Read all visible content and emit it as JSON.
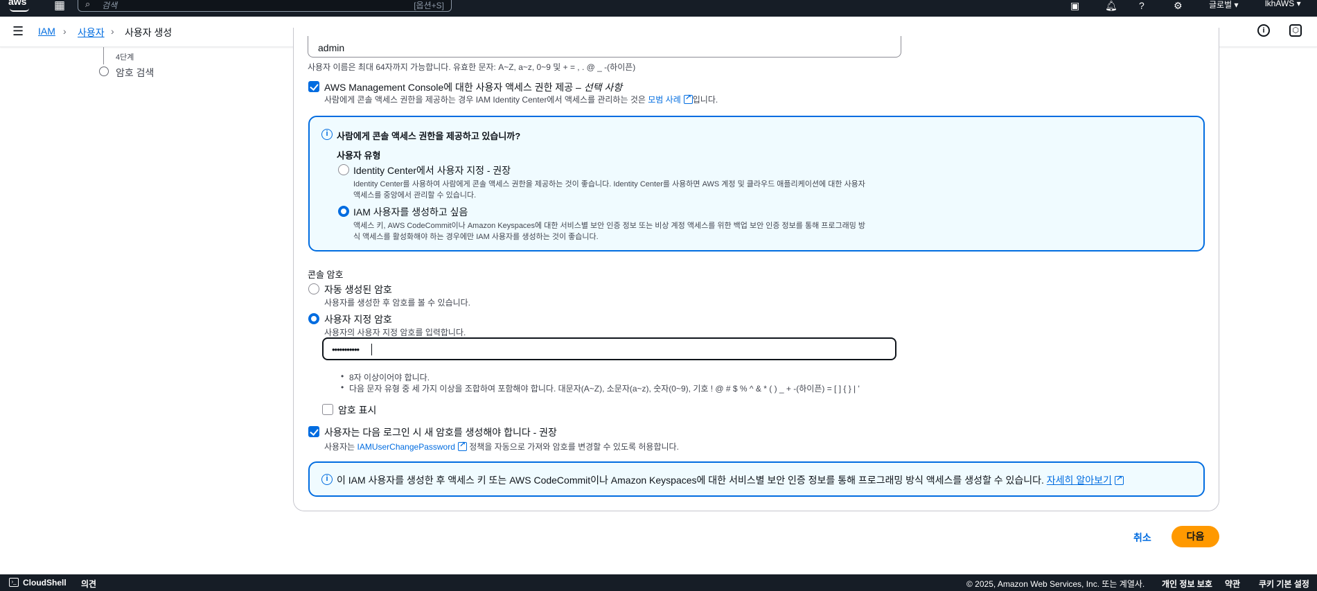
{
  "topbar": {
    "logo": "aws",
    "search_placeholder": "검색",
    "search_shortcut": "[옵션+S]",
    "region": "글로벌 ▾",
    "account": "lkhAWS ▾",
    "icons": [
      "cloudshell-icon",
      "bell-icon",
      "help-icon",
      "gear-icon"
    ]
  },
  "breadcrumb": {
    "items": [
      "IAM",
      "사용자",
      "사용자 생성"
    ]
  },
  "sidebar": {
    "step_label": "4단계",
    "step_title": "암호 검색"
  },
  "form": {
    "username_value": "admin",
    "username_hint": "사용자 이름은 최대 64자까지 가능합니다. 유효한 문자: A~Z, a~z, 0~9 및 + = , . @ _ -(하이픈)",
    "console_access_label": "AWS Management Console에 대한 사용자 액세스 권한 제공 – ",
    "console_access_optional": "선택 사항",
    "console_access_desc_pre": "사람에게 콘솔 액세스 권한을 제공하는 경우 IAM Identity Center에서 액세스를 관리하는 것은 ",
    "console_access_link": "모범 사례",
    "console_access_desc_post": "입니다.",
    "console_access_checked": true,
    "infobox1": {
      "title": "사람에게 콘솔 액세스 권한을 제공하고 있습니까?",
      "user_type_label": "사용자 유형",
      "option1_label": "Identity Center에서 사용자 지정 - 권장",
      "option1_desc1": "Identity Center를 사용하여 사람에게 콘솔 액세스 권한을 제공하는 것이 좋습니다. Identity Center를 사용하면 AWS 계정 및 클라우드 애플리케이션에 대한 사용자",
      "option1_desc2": "액세스를 중앙에서 관리할 수 있습니다.",
      "option2_label": "IAM 사용자를 생성하고 싶음",
      "option2_desc1": "액세스 키, AWS CodeCommit이나 Amazon Keyspaces에 대한 서비스별 보안 인증 정보 또는 비상 계정 액세스를 위한 백업 보안 인증 정보를 통해 프로그래밍 방",
      "option2_desc2": "식 액세스를 활성화해야 하는 경우에만 IAM 사용자를 생성하는 것이 좋습니다.",
      "selected": "option2"
    },
    "console_password": {
      "section_label": "콘솔 암호",
      "auto_label": "자동 생성된 암호",
      "auto_desc": "사용자를 생성한 후 암호를 볼 수 있습니다.",
      "custom_label": "사용자 지정 암호",
      "custom_desc": "사용자의 사용자 지정 암호를 입력합니다.",
      "selected": "custom",
      "password_value": "•••••••••••",
      "rule1": "8자 이상이어야 합니다.",
      "rule2": "다음 문자 유형 중 세 가지 이상을 조합하여 포함해야 합니다. 대문자(A~Z), 소문자(a~z), 숫자(0~9), 기호 ! @ # $ % ^ & * ( ) _ + -(하이픈) = [ ] { } | '",
      "show_password_label": "암호 표시",
      "show_password_checked": false
    },
    "reset_password": {
      "label": "사용자는 다음 로그인 시 새 암호를 생성해야 합니다 - 권장",
      "desc_pre": "사용자는 ",
      "desc_link": "IAMUserChangePassword",
      "desc_post": " 정책을 자동으로 가져와 암호를 변경할 수 있도록 허용합니다.",
      "checked": true
    },
    "infobox2": {
      "text": "이 IAM 사용자를 생성한 후 액세스 키 또는 AWS CodeCommit이나 Amazon Keyspaces에 대한 서비스별 보안 인증 정보를 통해 프로그래밍 방식 액세스를 생성할 수 있습니다. ",
      "link": "자세히 알아보기"
    }
  },
  "actions": {
    "cancel": "취소",
    "next": "다음"
  },
  "footer": {
    "cloudshell": "CloudShell",
    "feedback": "의견",
    "copyright": "© 2025, Amazon Web Services, Inc. 또는 계열사.",
    "privacy": "개인 정보 보호",
    "terms": "약관",
    "cookies": "쿠키 기본 설정"
  }
}
